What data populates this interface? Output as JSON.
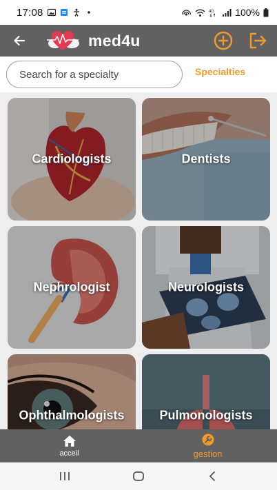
{
  "status_bar": {
    "time": "17:08",
    "left_icons": [
      "image-icon",
      "calendar-icon",
      "accessibility-icon",
      "dot-icon"
    ],
    "right_icons": [
      "hotspot-icon",
      "wifi-icon",
      "data-4g-icon",
      "signal-icon"
    ],
    "battery": "100%"
  },
  "app_bar": {
    "title": "med4u",
    "back_icon": "arrow-left-icon",
    "logo_icon": "heart-pulse-logo",
    "add_icon": "add-circle-icon",
    "logout_icon": "logout-icon",
    "bar_color": "#616161",
    "accent": "#f39a2b"
  },
  "search": {
    "placeholder": "Search for a specialty",
    "value": ""
  },
  "tabs": {
    "specialties_label": "Specialties"
  },
  "specialties": [
    {
      "label": "Cardiologists"
    },
    {
      "label": "Dentists"
    },
    {
      "label": "Nephrologist"
    },
    {
      "label": "Neurologists"
    },
    {
      "label": "Ophthalmologists"
    },
    {
      "label": "Pulmonologists"
    }
  ],
  "bottom_nav": {
    "items": [
      {
        "label": "acceil",
        "icon": "home-icon",
        "active": false
      },
      {
        "label": "gestion",
        "icon": "settings-icon",
        "active": true
      }
    ]
  },
  "system_nav": {
    "icons": [
      "recent-apps-icon",
      "home-circle-icon",
      "back-chevron-icon"
    ]
  }
}
